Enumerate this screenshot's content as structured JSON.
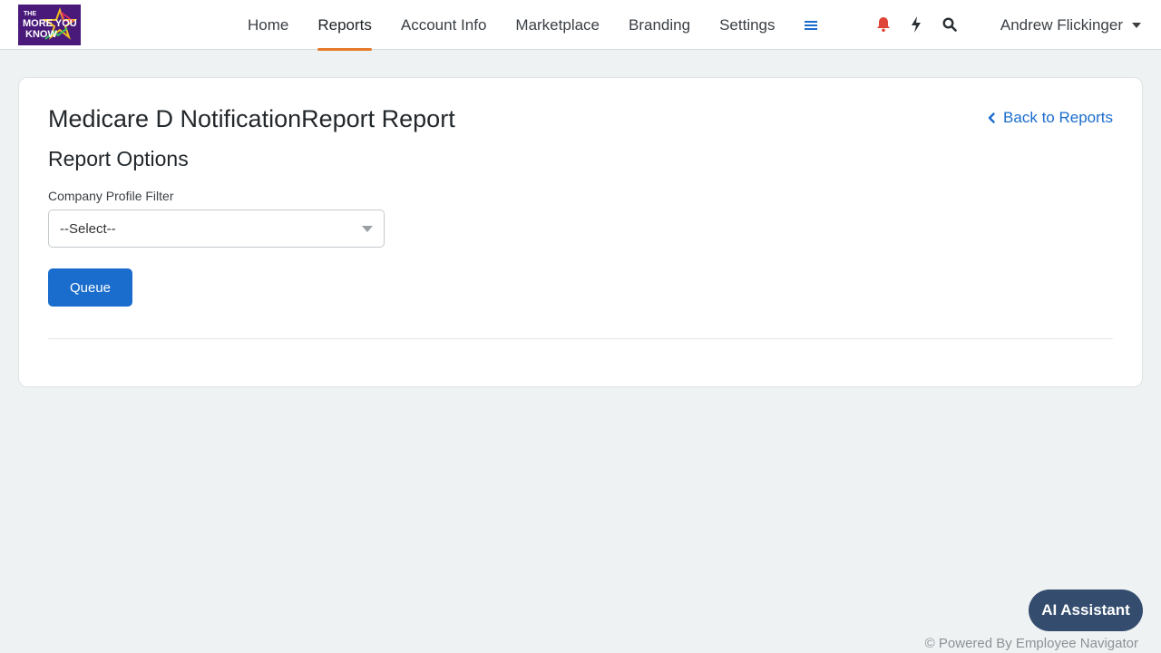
{
  "brand": {
    "logo_text_lines": [
      "THE",
      "MORE YOU",
      "KNOW"
    ],
    "logo_bg_color": "#4a1a7a"
  },
  "nav": {
    "items": [
      {
        "label": "Home",
        "active": false
      },
      {
        "label": "Reports",
        "active": true
      },
      {
        "label": "Account Info",
        "active": false
      },
      {
        "label": "Marketplace",
        "active": false
      },
      {
        "label": "Branding",
        "active": false
      },
      {
        "label": "Settings",
        "active": false
      }
    ],
    "more_icon": "hamburger-menu-icon",
    "active_underline_color": "#e57a2a"
  },
  "toolbar": {
    "notifications_icon": "bell-icon",
    "notifications_color": "#e0453a",
    "quick_actions_icon": "lightning-bolt-icon",
    "search_icon": "search-icon"
  },
  "user": {
    "name": "Andrew Flickinger"
  },
  "page": {
    "title": "Medicare D NotificationReport Report",
    "back_link": "Back to Reports",
    "section_title": "Report Options",
    "filter": {
      "label": "Company Profile Filter",
      "selected": "--Select--"
    },
    "queue_button": "Queue"
  },
  "assistant_button": "AI Assistant",
  "footer": "© Powered By Employee Navigator",
  "colors": {
    "primary": "#1a6ccd",
    "background": "#eff2f3",
    "assistant": "#344d6e"
  }
}
